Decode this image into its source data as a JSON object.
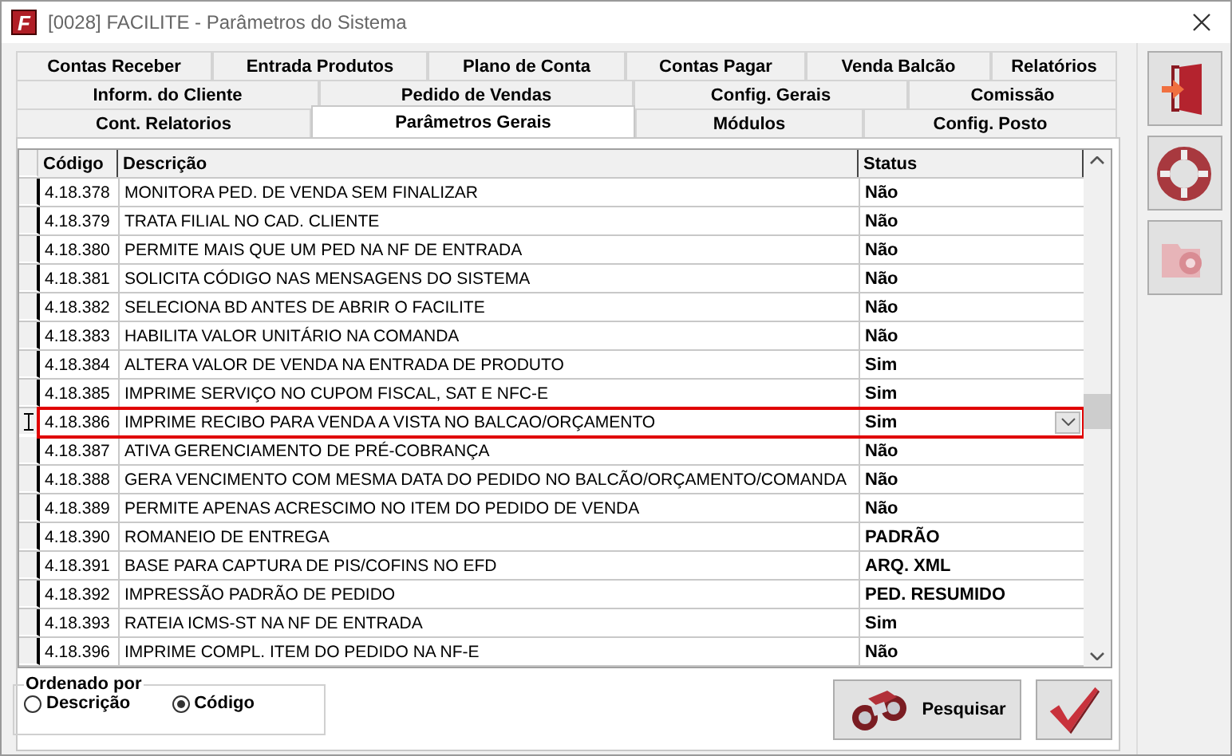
{
  "window": {
    "title": "[0028] FACILITE - Parâmetros do Sistema",
    "app_logo": "F"
  },
  "tab_rows": [
    [
      {
        "label": "Contas Receber",
        "selected": false
      },
      {
        "label": "Entrada Produtos",
        "selected": false
      },
      {
        "label": "Plano de Conta",
        "selected": false
      },
      {
        "label": "Contas Pagar",
        "selected": false
      },
      {
        "label": "Venda Balcão",
        "selected": false
      },
      {
        "label": "Relatórios",
        "selected": false
      }
    ],
    [
      {
        "label": "Inform. do Cliente",
        "selected": false
      },
      {
        "label": "Pedido de Vendas",
        "selected": false
      },
      {
        "label": "Config. Gerais",
        "selected": false
      },
      {
        "label": "Comissão",
        "selected": false
      }
    ],
    [
      {
        "label": "Cont. Relatorios",
        "selected": false
      },
      {
        "label": "Parâmetros Gerais",
        "selected": true
      },
      {
        "label": "Módulos",
        "selected": false
      },
      {
        "label": "Config. Posto",
        "selected": false
      }
    ]
  ],
  "table": {
    "columns": [
      "Código",
      "Descrição",
      "Status"
    ],
    "rows": [
      {
        "code": "4.18.378",
        "description": "MONITORA PED. DE VENDA SEM FINALIZAR",
        "status": "Não",
        "selected": false
      },
      {
        "code": "4.18.379",
        "description": "TRATA FILIAL NO CAD. CLIENTE",
        "status": "Não",
        "selected": false
      },
      {
        "code": "4.18.380",
        "description": "PERMITE MAIS QUE UM PED NA NF DE ENTRADA",
        "status": "Não",
        "selected": false
      },
      {
        "code": "4.18.381",
        "description": "SOLICITA CÓDIGO NAS MENSAGENS DO SISTEMA",
        "status": "Não",
        "selected": false
      },
      {
        "code": "4.18.382",
        "description": "SELECIONA BD ANTES DE ABRIR O FACILITE",
        "status": "Não",
        "selected": false
      },
      {
        "code": "4.18.383",
        "description": "HABILITA VALOR UNITÁRIO NA COMANDA",
        "status": "Não",
        "selected": false
      },
      {
        "code": "4.18.384",
        "description": "ALTERA VALOR DE VENDA NA ENTRADA DE PRODUTO",
        "status": "Sim",
        "selected": false
      },
      {
        "code": "4.18.385",
        "description": "IMPRIME SERVIÇO NO CUPOM FISCAL, SAT E NFC-E",
        "status": "Sim",
        "selected": false
      },
      {
        "code": "4.18.386",
        "description": "IMPRIME RECIBO PARA VENDA A VISTA NO BALCAO/ORÇAMENTO",
        "status": "Sim",
        "selected": true
      },
      {
        "code": "4.18.387",
        "description": "ATIVA GERENCIAMENTO DE PRÉ-COBRANÇA",
        "status": "Não",
        "selected": false
      },
      {
        "code": "4.18.388",
        "description": "GERA VENCIMENTO COM MESMA DATA DO PEDIDO NO BALCÃO/ORÇAMENTO/COMANDA",
        "status": "Não",
        "selected": false
      },
      {
        "code": "4.18.389",
        "description": "PERMITE APENAS ACRESCIMO NO ITEM DO PEDIDO DE VENDA",
        "status": "Não",
        "selected": false
      },
      {
        "code": "4.18.390",
        "description": "ROMANEIO DE ENTREGA",
        "status": "PADRÃO",
        "selected": false
      },
      {
        "code": "4.18.391",
        "description": "BASE PARA CAPTURA DE PIS/COFINS NO EFD",
        "status": "ARQ. XML",
        "selected": false
      },
      {
        "code": "4.18.392",
        "description": "IMPRESSÃO PADRÃO DE PEDIDO",
        "status": "PED. RESUMIDO",
        "selected": false
      },
      {
        "code": "4.18.393",
        "description": "RATEIA ICMS-ST NA NF DE ENTRADA",
        "status": "Sim",
        "selected": false
      },
      {
        "code": "4.18.396",
        "description": "IMPRIME COMPL. ITEM DO PEDIDO NA NF-E",
        "status": "Não",
        "selected": false
      }
    ]
  },
  "sort_group": {
    "title": "Ordenado por",
    "options": [
      {
        "label": "Descrição",
        "selected": false
      },
      {
        "label": "Código",
        "selected": true
      }
    ]
  },
  "search_button": "Pesquisar"
}
